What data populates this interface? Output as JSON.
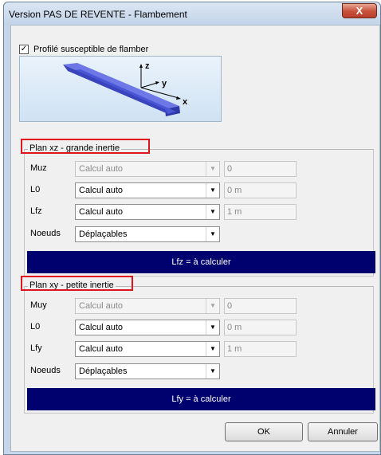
{
  "window": {
    "title": "Version PAS DE REVENTE - Flambement",
    "close_glyph": "X"
  },
  "checkbox": {
    "label": "Profilé susceptible de flamber",
    "checked": true,
    "check_glyph": "✓"
  },
  "beam_image": {
    "axis_z": "z",
    "axis_y": "y",
    "axis_x": "x",
    "beam_color": "#4a55d6"
  },
  "plan_xz": {
    "title": "Plan xz - grande inertie",
    "rows": [
      {
        "label": "Muz",
        "select": "Calcul auto",
        "field": "0",
        "disabled": true
      },
      {
        "label": "L0",
        "select": "Calcul auto",
        "field": "0 m",
        "disabled": false
      },
      {
        "label": "Lfz",
        "select": "Calcul auto",
        "field": "1 m",
        "disabled": false
      },
      {
        "label": "Noeuds",
        "select": "Déplaçables"
      }
    ],
    "banner": "Lfz = à calculer"
  },
  "plan_xy": {
    "title": "Plan xy - petite inertie",
    "rows": [
      {
        "label": "Muy",
        "select": "Calcul auto",
        "field": "0",
        "disabled": true
      },
      {
        "label": "L0",
        "select": "Calcul auto",
        "field": "0 m",
        "disabled": false
      },
      {
        "label": "Lfy",
        "select": "Calcul auto",
        "field": "1 m",
        "disabled": false
      },
      {
        "label": "Noeuds",
        "select": "Déplaçables"
      }
    ],
    "banner": "Lfy = à calculer"
  },
  "buttons": {
    "ok": "OK",
    "cancel": "Annuler"
  },
  "colors": {
    "banner_bg": "#00006f",
    "highlight_box": "#e0141e"
  }
}
